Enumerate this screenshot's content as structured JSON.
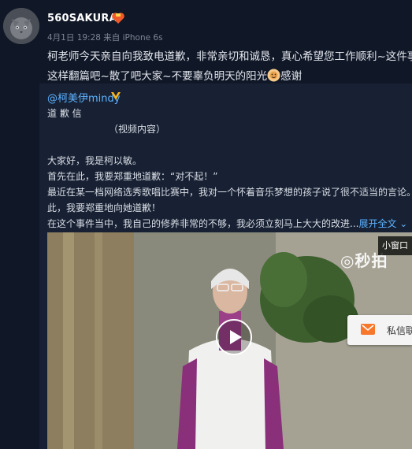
{
  "post": {
    "username": "560SAKURA",
    "meta": "4月1日 19:28 来自 iPhone 6s",
    "text_lines": [
      "柯老师今天亲自向我致电道歉，非常亲切和诚恳，真心希望您工作顺利~这件事就",
      "这样翻篇吧~散了吧大家~不要辜负明天的阳光",
      "感谢"
    ]
  },
  "repost": {
    "author": "@柯美伊mindy",
    "lines": [
      "道 歉 信",
      "（视频内容）",
      "大家好，我是柯以敏。",
      "首先在此，我要郑重地道歉：“对不起！”",
      "最近在某一档网络选秀歌唱比赛中，我对一个怀着音乐梦想的孩子说了很不适当的言论。在",
      "此，我要郑重地向她道歉！",
      "在这个事件当中，我自己的修养非常的不够，我必须立刻马上大大的改进..."
    ],
    "expand_link": "展开全文 ⌄"
  },
  "video": {
    "watermark": "◎秒拍",
    "small_window_label": "小窗口",
    "pm_label": "私信联"
  },
  "colors": {
    "background": "#0f1624",
    "repost_bg": "#172133",
    "link": "#5db1ff"
  },
  "icons": [
    "avatar-cat",
    "vip-badge-icon",
    "sun-emoji-icon",
    "play-icon",
    "mail-icon"
  ]
}
